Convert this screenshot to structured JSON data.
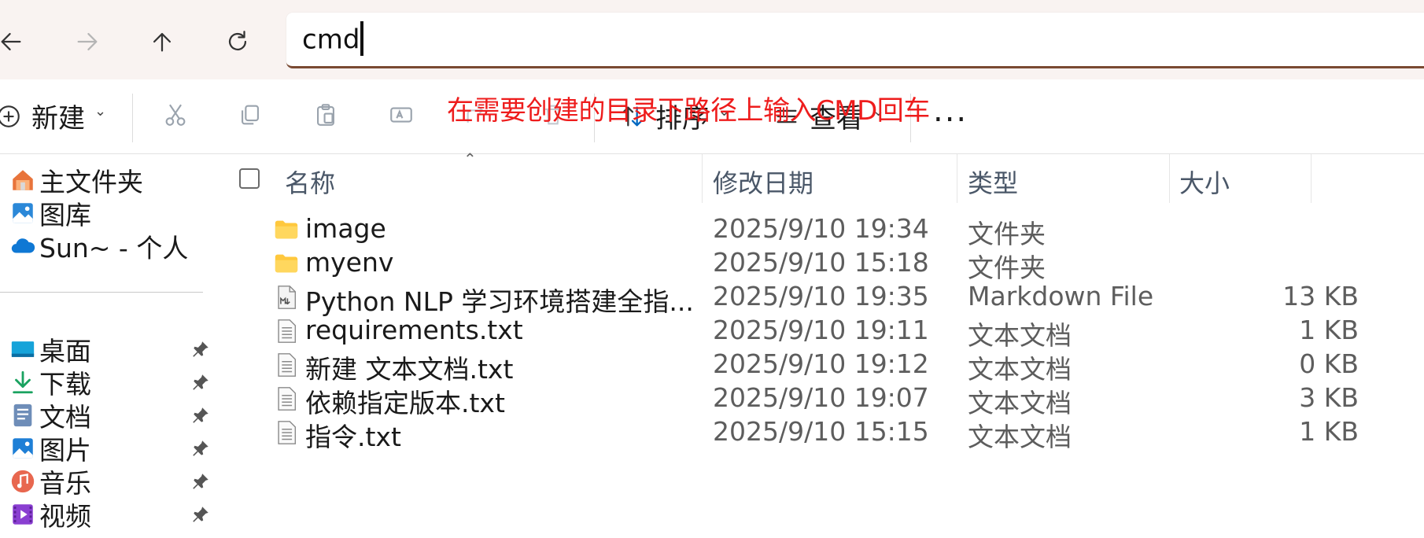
{
  "address_bar": {
    "value": "cmd"
  },
  "annotation": "在需要创建的目录下路径上输入CMD回车",
  "nav": {
    "back": "arrow-left-icon",
    "forward": "arrow-right-icon",
    "up": "arrow-up-icon",
    "refresh": "refresh-icon"
  },
  "command_bar": {
    "new_label": "新建",
    "sort_label": "排序",
    "view_label": "查看",
    "more_label": "..."
  },
  "sidebar": {
    "top_items": [
      {
        "label": "主文件夹",
        "icon": "home-icon"
      },
      {
        "label": "图库",
        "icon": "gallery-icon"
      },
      {
        "label": "Sun~ - 个人",
        "icon": "onedrive-cloud-icon"
      }
    ],
    "pinned_items": [
      {
        "label": "桌面",
        "icon": "desktop-icon"
      },
      {
        "label": "下载",
        "icon": "download-icon"
      },
      {
        "label": "文档",
        "icon": "documents-icon"
      },
      {
        "label": "图片",
        "icon": "pictures-icon"
      },
      {
        "label": "音乐",
        "icon": "music-icon"
      },
      {
        "label": "视频",
        "icon": "videos-icon"
      }
    ]
  },
  "columns": {
    "name": "名称",
    "modified": "修改日期",
    "type": "类型",
    "size": "大小"
  },
  "files": [
    {
      "name": "image",
      "modified": "2025/9/10 19:34",
      "type": "文件夹",
      "size": "",
      "icon": "folder-icon"
    },
    {
      "name": "myenv",
      "modified": "2025/9/10 15:18",
      "type": "文件夹",
      "size": "",
      "icon": "folder-icon"
    },
    {
      "name": "Python NLP 学习环境搭建全指...",
      "modified": "2025/9/10 19:35",
      "type": "Markdown File",
      "size": "13 KB",
      "icon": "markdown-file-icon"
    },
    {
      "name": "requirements.txt",
      "modified": "2025/9/10 19:11",
      "type": "文本文档",
      "size": "1 KB",
      "icon": "text-file-icon"
    },
    {
      "name": "新建 文本文档.txt",
      "modified": "2025/9/10 19:12",
      "type": "文本文档",
      "size": "0 KB",
      "icon": "text-file-icon"
    },
    {
      "name": "依赖指定版本.txt",
      "modified": "2025/9/10 19:07",
      "type": "文本文档",
      "size": "3 KB",
      "icon": "text-file-icon"
    },
    {
      "name": "指令.txt",
      "modified": "2025/9/10 15:15",
      "type": "文本文档",
      "size": "1 KB",
      "icon": "text-file-icon"
    }
  ],
  "colors": {
    "annotation": "#ee1c1c",
    "address_underline": "#7a4a32",
    "folder": "#ffc83d",
    "accent": "#0067c0"
  }
}
